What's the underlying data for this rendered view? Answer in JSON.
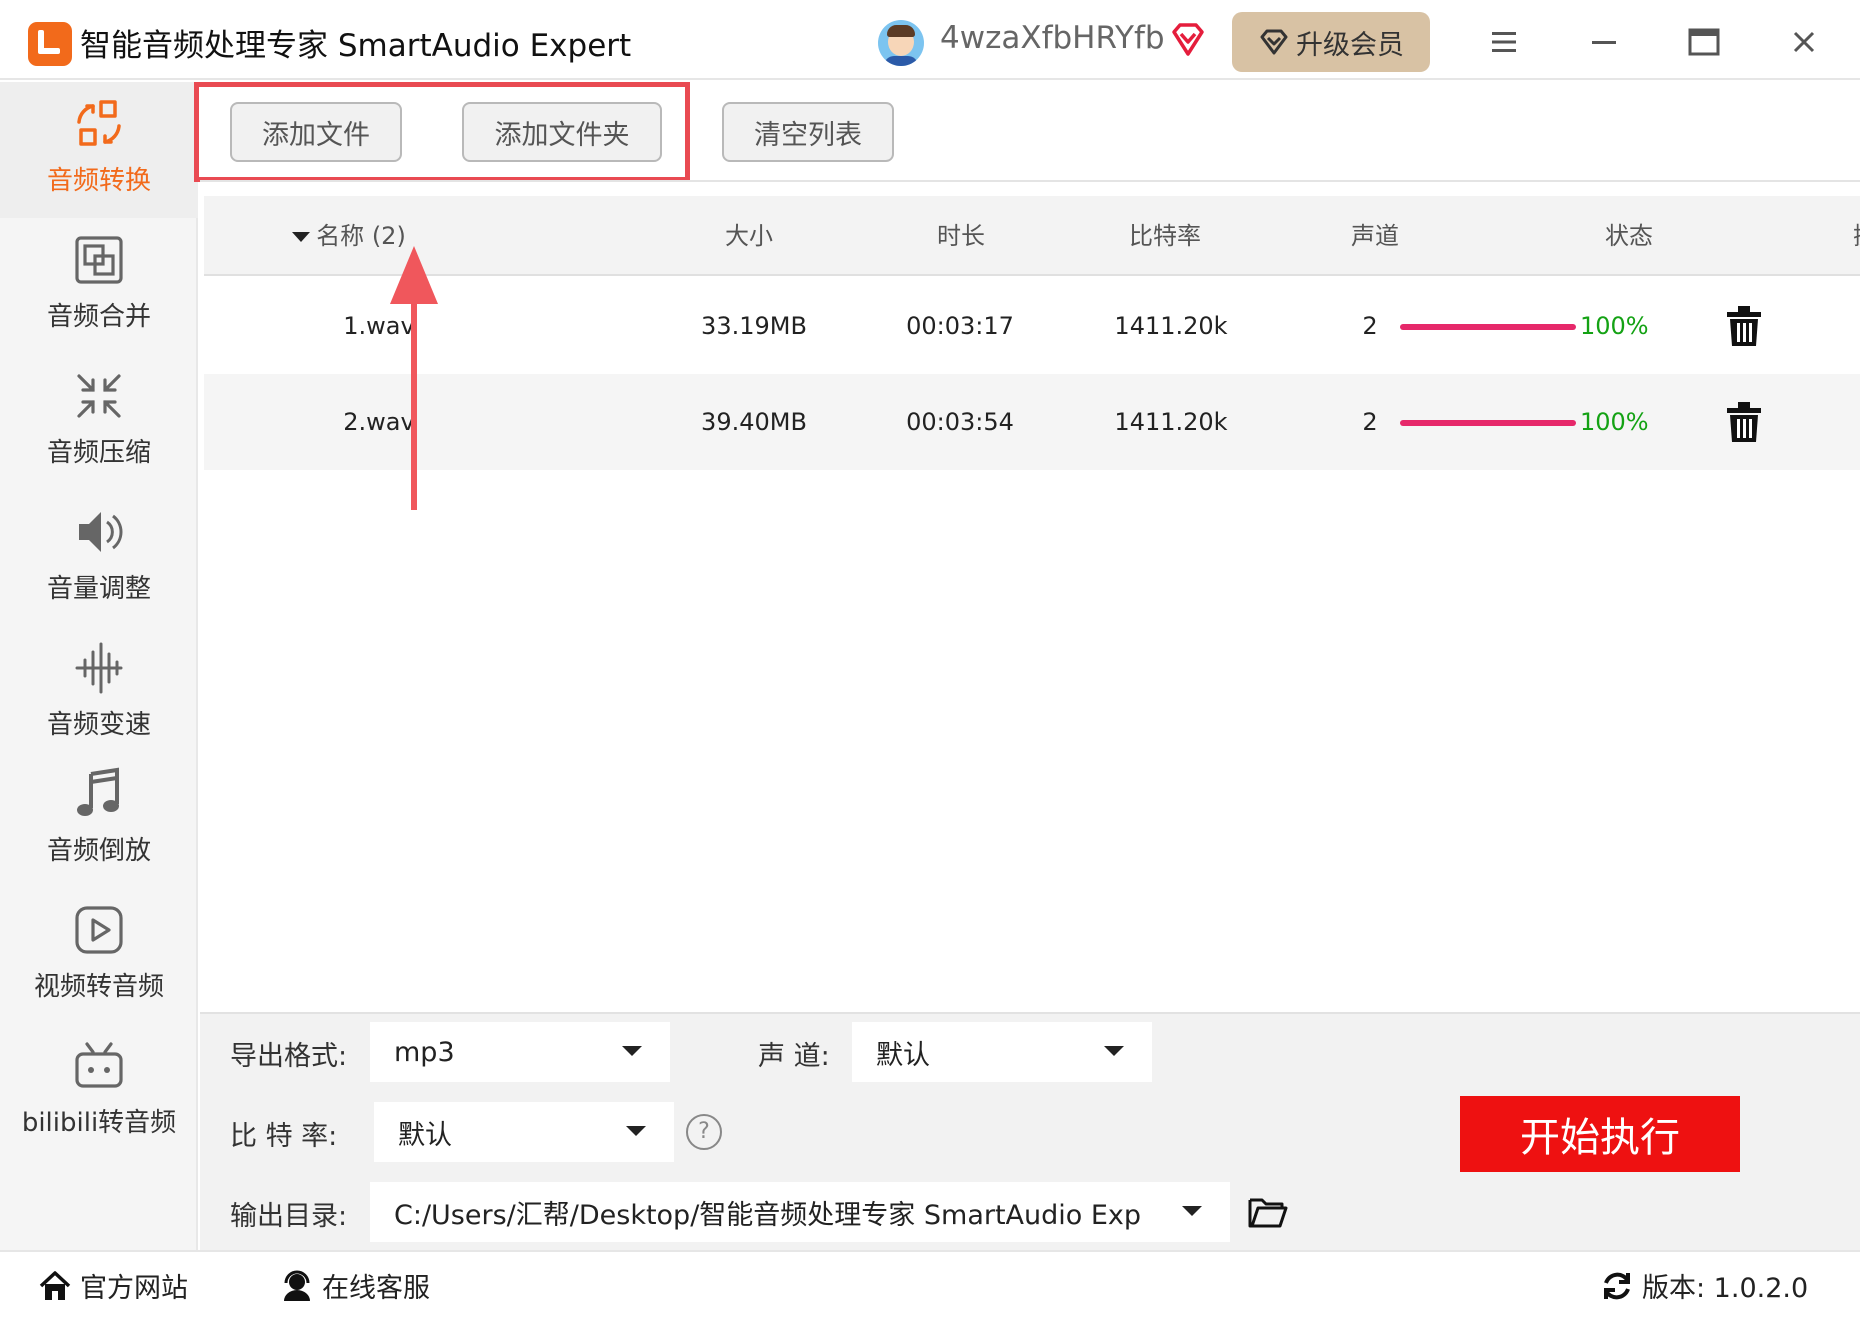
{
  "app": {
    "title": "智能音频处理专家 SmartAudio Expert",
    "username": "4wzaXfbHRYfb",
    "upgrade_label": "升级会员"
  },
  "sidebar": {
    "items": [
      {
        "label": "音频转换",
        "icon": "convert-icon",
        "active": true
      },
      {
        "label": "音频合并",
        "icon": "merge-icon"
      },
      {
        "label": "音频压缩",
        "icon": "compress-icon"
      },
      {
        "label": "音量调整",
        "icon": "volume-icon"
      },
      {
        "label": "音频变速",
        "icon": "speed-icon"
      },
      {
        "label": "音频倒放",
        "icon": "music-note-icon"
      },
      {
        "label": "视频转音频",
        "icon": "video-play-icon"
      },
      {
        "label": "bilibili转音频",
        "icon": "bilibili-icon"
      }
    ]
  },
  "toolbar": {
    "add_file": "添加文件",
    "add_folder": "添加文件夹",
    "clear_list": "清空列表"
  },
  "table": {
    "columns": [
      "名称 (2)",
      "大小",
      "时长",
      "比特率",
      "声道",
      "状态",
      "操作"
    ],
    "rows": [
      {
        "name": "1.wav",
        "size": "33.19MB",
        "duration": "00:03:17",
        "bitrate": "1411.20k",
        "channels": "2",
        "progress": 1.0,
        "status": "100%"
      },
      {
        "name": "2.wav",
        "size": "39.40MB",
        "duration": "00:03:54",
        "bitrate": "1411.20k",
        "channels": "2",
        "progress": 1.0,
        "status": "100%"
      }
    ]
  },
  "settings": {
    "format_label": "导出格式:",
    "format_value": "mp3",
    "channel_label": "声 道:",
    "channel_value": "默认",
    "bitrate_label": "比 特 率:",
    "bitrate_value": "默认",
    "output_label": "输出目录:",
    "output_value": "C:/Users/汇帮/Desktop/智能音频处理专家 SmartAudio Exp",
    "start_label": "开始执行"
  },
  "statusbar": {
    "website": "官方网站",
    "support": "在线客服",
    "version": "版本: 1.0.2.0"
  },
  "colors": {
    "accent": "#f26a1b",
    "highlight": "#e94a52",
    "progress": "#e6286a",
    "success": "#14a214",
    "start": "#ee1111",
    "upgrade": "#d8c2a4"
  }
}
